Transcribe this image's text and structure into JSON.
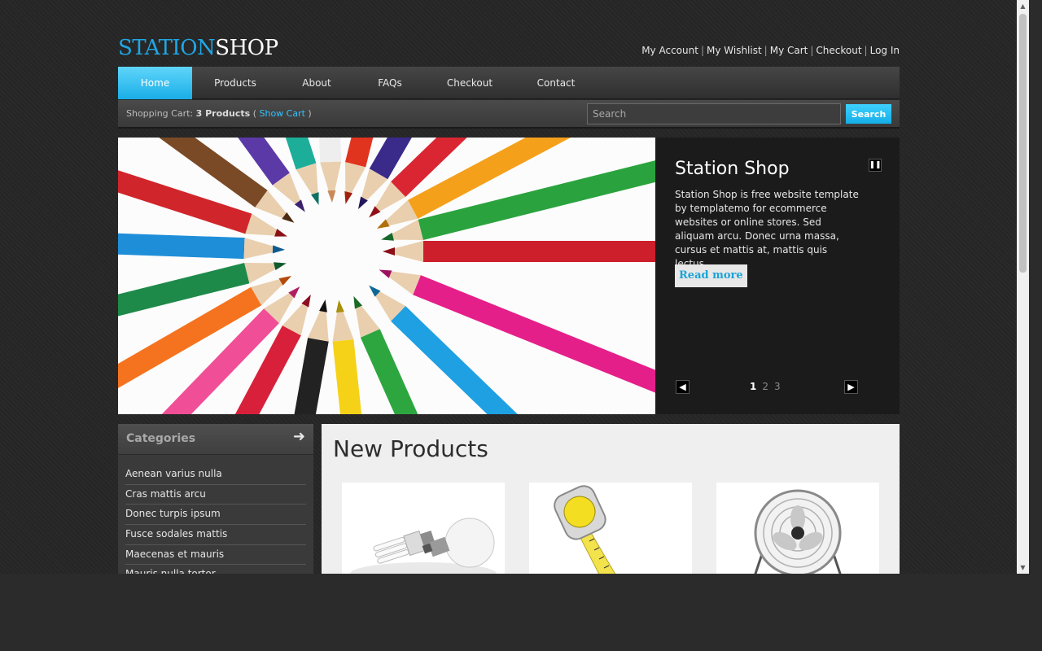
{
  "header": {
    "logo_part1": "STATION",
    "logo_part2": "SHOP",
    "links": [
      "My Account",
      "My Wishlist",
      "My Cart",
      "Checkout",
      "Log In"
    ]
  },
  "menu": {
    "items": [
      "Home",
      "Products",
      "About",
      "FAQs",
      "Checkout",
      "Contact"
    ],
    "active": "Home"
  },
  "cart": {
    "label": "Shopping Cart:",
    "count": "3 Products",
    "open_paren": "(",
    "show_cart": "Show Cart",
    "close_paren": ")"
  },
  "search": {
    "placeholder": "Search",
    "button": "Search"
  },
  "slider": {
    "title": "Station Shop",
    "description": "Station Shop is free website template by templatemo for ecommerce websites or online stores. Sed aliquam arcu. Donec urna massa, cursus et mattis at, mattis quis lectus.",
    "read_more": "Read more",
    "pages": [
      "1",
      "2",
      "3"
    ],
    "current_page": "1"
  },
  "sidebar": {
    "title": "Categories",
    "items": [
      "Aenean varius nulla",
      "Cras mattis arcu",
      "Donec turpis ipsum",
      "Fusce sodales mattis",
      "Maecenas et mauris",
      "Mauris nulla tortor"
    ]
  },
  "products": {
    "title": "New Products",
    "items": [
      {
        "icon": "light-bulb-image"
      },
      {
        "icon": "tape-measure-image"
      },
      {
        "icon": "desk-fan-image"
      }
    ]
  },
  "colors": {
    "accent": "#1fa7e5",
    "background": "#262626"
  }
}
